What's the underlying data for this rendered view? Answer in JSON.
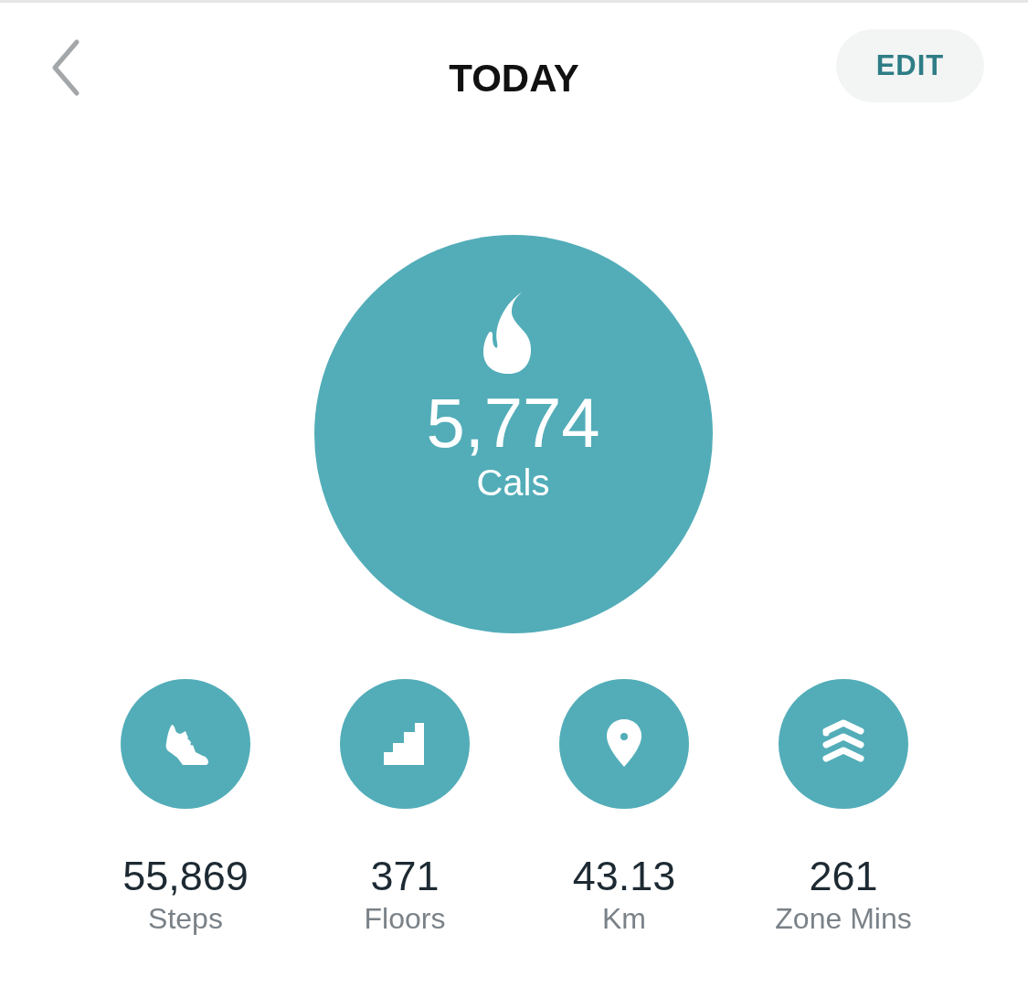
{
  "header": {
    "title": "TODAY",
    "action_button": "EDIT"
  },
  "main_stat": {
    "kind": "calories",
    "value": "5,774",
    "unit": "Cals"
  },
  "stats": [
    {
      "kind": "steps",
      "value": "55,869",
      "label": "Steps"
    },
    {
      "kind": "floors",
      "value": "371",
      "label": "Floors"
    },
    {
      "kind": "distance",
      "value": "43.13",
      "label": "Km"
    },
    {
      "kind": "zone",
      "value": "261",
      "label": "Zone Mins"
    }
  ]
}
